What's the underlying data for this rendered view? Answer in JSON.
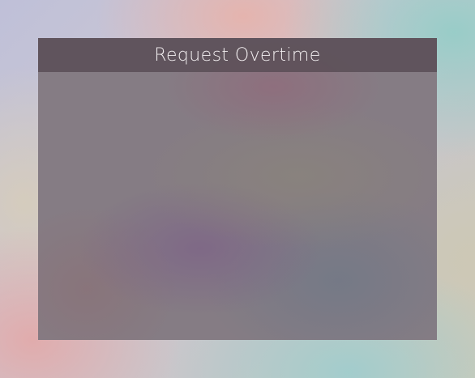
{
  "dialog": {
    "title": "Request Overtime"
  }
}
